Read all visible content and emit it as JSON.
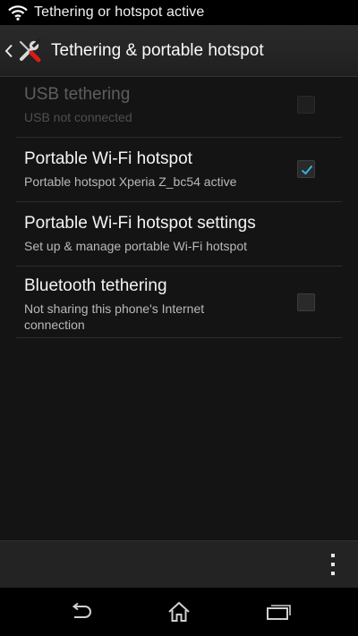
{
  "status_bar": {
    "notification_text": "Tethering or hotspot active",
    "icon": "wifi-hotspot-icon"
  },
  "action_bar": {
    "title": "Tethering & portable hotspot",
    "up_icon": "chevron-left-icon",
    "app_icon": "tools-icon"
  },
  "preferences": [
    {
      "title": "USB tethering",
      "summary": "USB not connected",
      "has_checkbox": true,
      "checked": false,
      "enabled": false
    },
    {
      "title": "Portable Wi-Fi hotspot",
      "summary": "Portable hotspot Xperia Z_bc54 active",
      "has_checkbox": true,
      "checked": true,
      "enabled": true
    },
    {
      "title": "Portable Wi-Fi hotspot settings",
      "summary": "Set up & manage portable Wi-Fi hotspot",
      "has_checkbox": false,
      "enabled": true
    },
    {
      "title": "Bluetooth tethering",
      "summary_line1": "Not sharing this phone's Internet",
      "summary_line2": "connection",
      "has_checkbox": true,
      "checked": false,
      "enabled": true
    }
  ],
  "overflow_menu_icon": "overflow-menu-icon",
  "nav_bar": {
    "back_icon": "back-icon",
    "home_icon": "home-icon",
    "recents_icon": "recent-apps-icon"
  },
  "colors": {
    "background": "#141414",
    "check_accent": "#33b5e5"
  }
}
